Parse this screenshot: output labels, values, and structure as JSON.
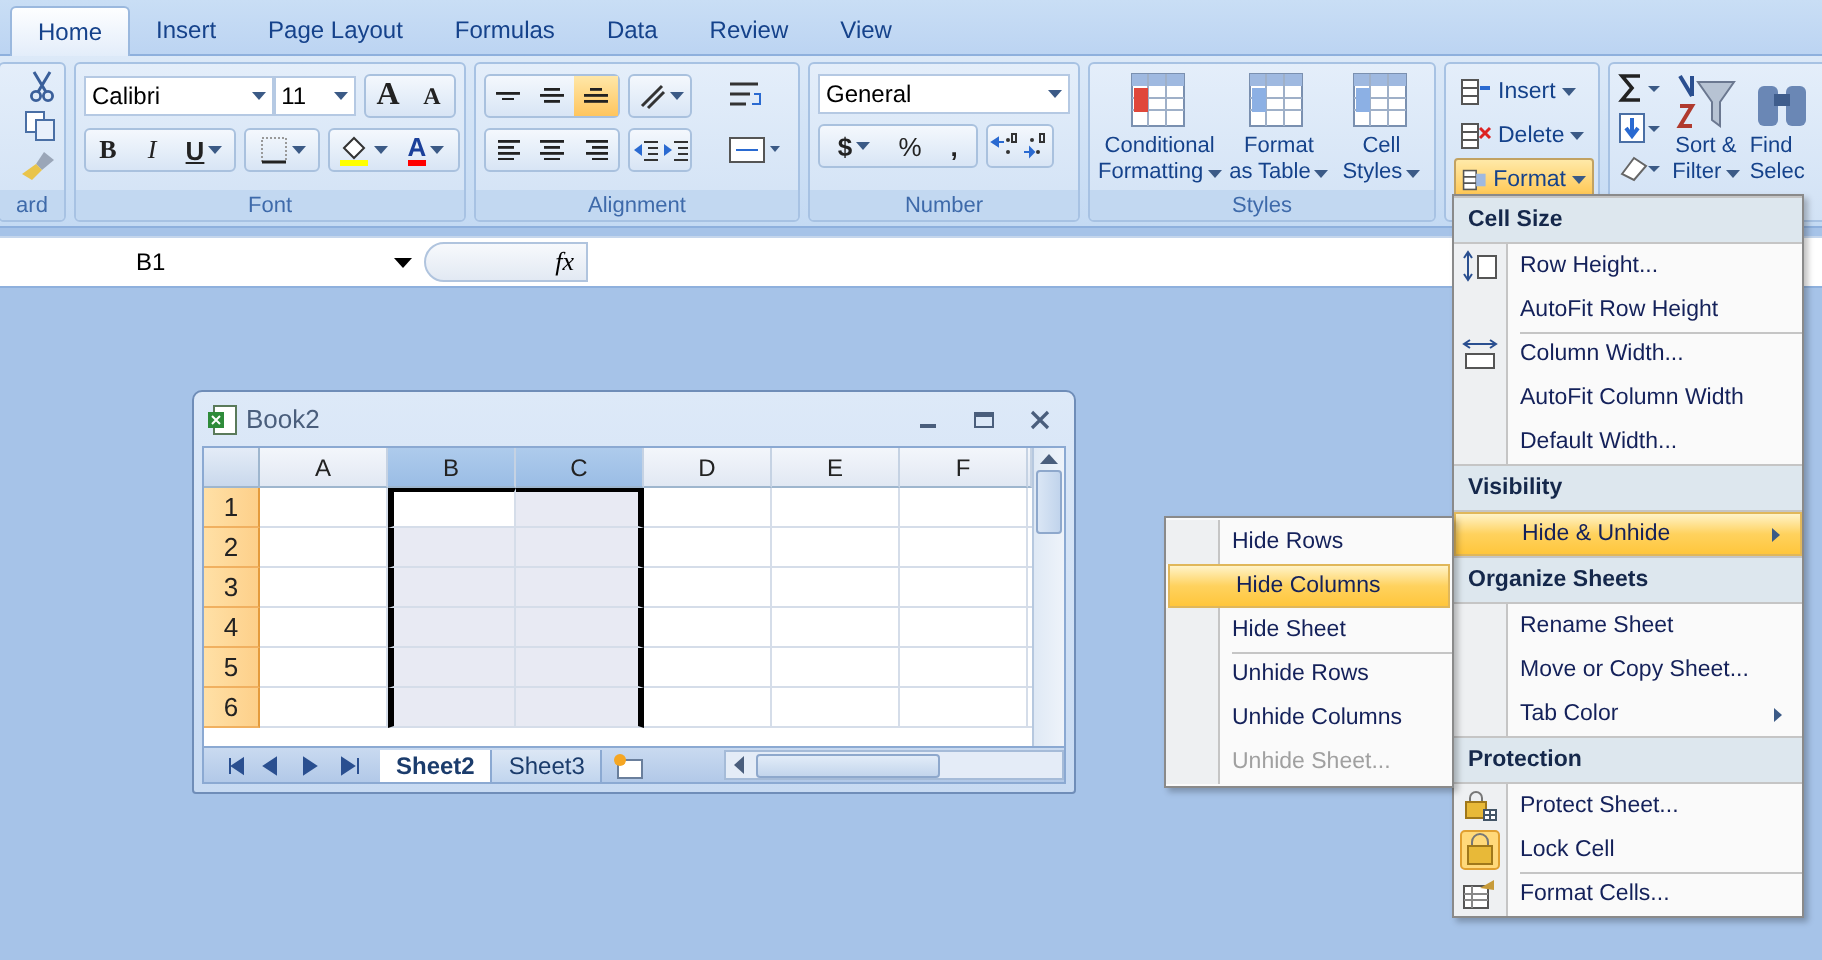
{
  "tabs": [
    {
      "label": "Home",
      "selected": true
    },
    {
      "label": "Insert",
      "selected": false
    },
    {
      "label": "Page Layout",
      "selected": false
    },
    {
      "label": "Formulas",
      "selected": false
    },
    {
      "label": "Data",
      "selected": false
    },
    {
      "label": "Review",
      "selected": false
    },
    {
      "label": "View",
      "selected": false
    }
  ],
  "clipboard": {
    "label": "ard"
  },
  "font": {
    "label": "Font",
    "font_name": "Calibri",
    "font_size": "11",
    "grow": "A",
    "shrink": "A",
    "bold": "B",
    "italic": "I",
    "underline": "U",
    "font_color": "A"
  },
  "alignment": {
    "label": "Alignment",
    "vertical": [
      {
        "kind": "top",
        "selected": false
      },
      {
        "kind": "middle",
        "selected": false
      },
      {
        "kind": "bottom",
        "selected": true
      }
    ]
  },
  "number": {
    "label": "Number",
    "format": "General",
    "currency": "$",
    "percent": "%",
    "comma": ","
  },
  "styles": {
    "label": "Styles",
    "buttons": [
      {
        "lines": [
          "Conditional",
          "Formatting"
        ]
      },
      {
        "lines": [
          "Format",
          "as Table"
        ]
      },
      {
        "lines": [
          "Cell",
          "Styles"
        ]
      }
    ]
  },
  "cells": {
    "buttons": [
      {
        "label": "Insert",
        "kind": "insert",
        "selected": false
      },
      {
        "label": "Delete",
        "kind": "delete",
        "selected": false
      },
      {
        "label": "Format",
        "kind": "format",
        "selected": true
      }
    ]
  },
  "editing": {
    "buttons": [
      {
        "lines": [
          "Sort &",
          "Filter"
        ],
        "kind": "sort"
      },
      {
        "lines": [
          "Find",
          "Selec"
        ],
        "kind": "find"
      }
    ]
  },
  "formula_bar": {
    "name_box": "B1",
    "fx": "fx"
  },
  "workbook": {
    "title": "Book2",
    "columns": [
      {
        "label": "A",
        "selected": false
      },
      {
        "label": "B",
        "selected": true
      },
      {
        "label": "C",
        "selected": true
      },
      {
        "label": "D",
        "selected": false
      },
      {
        "label": "E",
        "selected": false
      },
      {
        "label": "F",
        "selected": false
      }
    ],
    "rows": [
      "1",
      "2",
      "3",
      "4",
      "5",
      "6"
    ],
    "sheet_tabs": [
      {
        "label": "Sheet2",
        "selected": true
      },
      {
        "label": "Sheet3",
        "selected": false
      }
    ]
  },
  "format_menu": {
    "sections": [
      {
        "header": "Cell Size",
        "items": [
          {
            "label": "Row Height...",
            "divider": false,
            "selected": false,
            "submenu": false
          },
          {
            "label": "AutoFit Row Height",
            "divider": false,
            "selected": false,
            "submenu": false
          },
          {
            "label": "Column Width...",
            "divider": true,
            "selected": false,
            "submenu": false
          },
          {
            "label": "AutoFit Column Width",
            "divider": false,
            "selected": false,
            "submenu": false
          },
          {
            "label": "Default Width...",
            "divider": false,
            "selected": false,
            "submenu": false
          }
        ]
      },
      {
        "header": "Visibility",
        "items": [
          {
            "label": "Hide & Unhide",
            "divider": false,
            "selected": true,
            "submenu": true
          }
        ]
      },
      {
        "header": "Organize Sheets",
        "items": [
          {
            "label": "Rename Sheet",
            "divider": false,
            "selected": false,
            "submenu": false
          },
          {
            "label": "Move or Copy Sheet...",
            "divider": false,
            "selected": false,
            "submenu": false
          },
          {
            "label": "Tab Color",
            "divider": false,
            "selected": false,
            "submenu": true
          }
        ]
      },
      {
        "header": "Protection",
        "items": [
          {
            "label": "Protect Sheet...",
            "divider": false,
            "selected": false,
            "submenu": false
          },
          {
            "label": "Lock Cell",
            "divider": false,
            "selected": false,
            "submenu": false
          },
          {
            "label": "Format Cells...",
            "divider": true,
            "selected": false,
            "submenu": false
          }
        ]
      }
    ]
  },
  "submenu": {
    "items": [
      {
        "label": "Hide Rows",
        "divider": false,
        "selected": false,
        "disabled": false
      },
      {
        "label": "Hide Columns",
        "divider": false,
        "selected": true,
        "disabled": false
      },
      {
        "label": "Hide Sheet",
        "divider": false,
        "selected": false,
        "disabled": false
      },
      {
        "label": "Unhide Rows",
        "divider": true,
        "selected": false,
        "disabled": false
      },
      {
        "label": "Unhide Columns",
        "divider": false,
        "selected": false,
        "disabled": false
      },
      {
        "label": "Unhide Sheet...",
        "divider": false,
        "selected": false,
        "disabled": true
      }
    ]
  }
}
